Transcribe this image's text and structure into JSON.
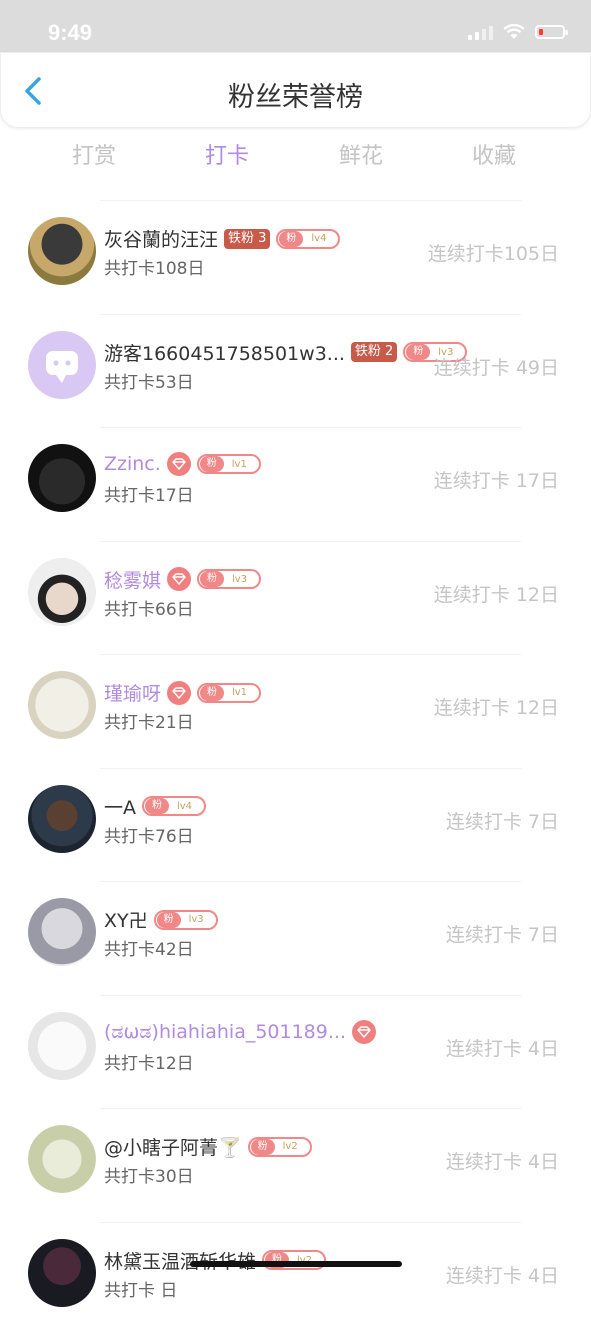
{
  "status": {
    "time": "9:49"
  },
  "nav": {
    "title": "粉丝荣誉榜"
  },
  "tabs": [
    {
      "label": "打赏",
      "active": false
    },
    {
      "label": "打卡",
      "active": true
    },
    {
      "label": "鲜花",
      "active": false
    },
    {
      "label": "收藏",
      "active": false
    }
  ],
  "colors": {
    "accent": "#b18be0",
    "fan_badge": "#f08888",
    "tie_badge": "#c85a4a",
    "muted": "#c5c5c5"
  },
  "fans": [
    {
      "name": "灰谷蘭的汪汪",
      "name_style": "normal",
      "tie": "铁粉 3",
      "diamond": false,
      "fan_label": "粉",
      "level": "lv4",
      "total": "共打卡108日",
      "streak": "连续打卡105日",
      "avatar_icon": "avatar-mask-icon"
    },
    {
      "name": "游客1660451758501w3...",
      "name_style": "normal",
      "tie": "铁粉 2",
      "diamond": false,
      "fan_label": "粉",
      "level": "lv3",
      "total": "共打卡53日",
      "streak": "连续打卡 49日",
      "avatar_icon": "avatar-guest-icon"
    },
    {
      "name": "Zzinc.",
      "name_style": "vip",
      "tie": "",
      "diamond": true,
      "fan_label": "粉",
      "level": "lv1",
      "total": "共打卡17日",
      "streak": "连续打卡 17日",
      "avatar_icon": "avatar-girl-icon"
    },
    {
      "name": "稔雾娸",
      "name_style": "vip",
      "tie": "",
      "diamond": true,
      "fan_label": "粉",
      "level": "lv3",
      "total": "共打卡66日",
      "streak": "连续打卡 12日",
      "avatar_icon": "avatar-hat-icon"
    },
    {
      "name": "瑾瑜呀",
      "name_style": "vip",
      "tie": "",
      "diamond": true,
      "fan_label": "粉",
      "level": "lv1",
      "total": "共打卡21日",
      "streak": "连续打卡 12日",
      "avatar_icon": "avatar-paper-icon"
    },
    {
      "name": "一A",
      "name_style": "normal",
      "tie": "",
      "diamond": false,
      "fan_label": "粉",
      "level": "lv4",
      "total": "共打卡76日",
      "streak": "连续打卡 7日",
      "avatar_icon": "avatar-boy-icon"
    },
    {
      "name": "XY卍",
      "name_style": "normal",
      "tie": "",
      "diamond": false,
      "fan_label": "粉",
      "level": "lv3",
      "total": "共打卡42日",
      "streak": "连续打卡 7日",
      "avatar_icon": "avatar-silver-icon"
    },
    {
      "name": "(ಡωಡ)hiahiahia_501189...",
      "name_style": "vip",
      "tie": "",
      "diamond": true,
      "fan_label": "",
      "level": "",
      "total": "共打卡12日",
      "streak": "连续打卡 4日",
      "avatar_icon": "avatar-sketch-icon"
    },
    {
      "name": "@小瞎子阿菁🍸",
      "name_style": "normal",
      "tie": "",
      "diamond": false,
      "fan_label": "粉",
      "level": "lv2",
      "total": "共打卡30日",
      "streak": "连续打卡 4日",
      "avatar_icon": "avatar-bear-icon"
    },
    {
      "name": "林黛玉温酒斩华雄",
      "name_style": "normal",
      "tie": "",
      "diamond": false,
      "fan_label": "粉",
      "level": "lv2",
      "total": "共打卡 日",
      "streak": "连续打卡 4日",
      "avatar_icon": "avatar-dark-icon"
    }
  ]
}
